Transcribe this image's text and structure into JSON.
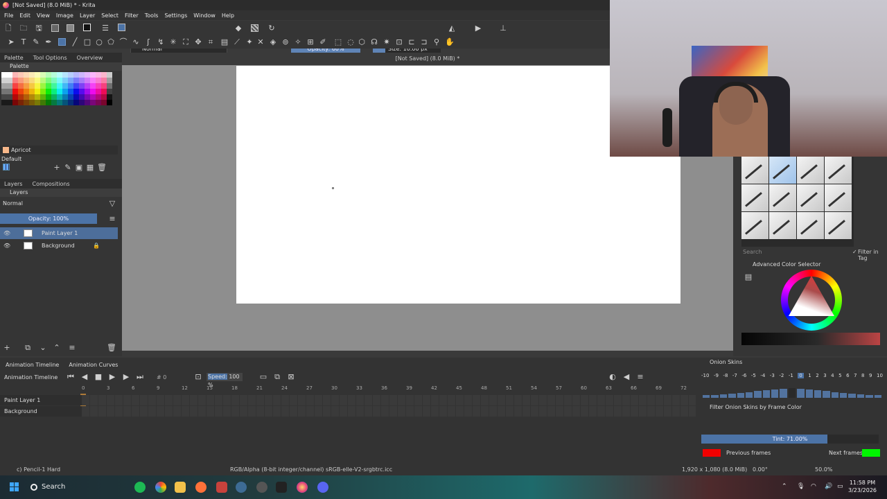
{
  "window": {
    "title": "[Not Saved]  (8.0 MiB) * - Krita"
  },
  "menu": [
    "File",
    "Edit",
    "View",
    "Image",
    "Layer",
    "Select",
    "Filter",
    "Tools",
    "Settings",
    "Window",
    "Help"
  ],
  "toolbar": {
    "blend_mode": "Normal",
    "opacity": "Opacity: 60%",
    "size": "Size: 10.00 px"
  },
  "left_dock": {
    "tabs": [
      "Palette",
      "Tool Options",
      "Overview"
    ],
    "palette_title": "Palette",
    "current_color": "Apricot",
    "palette_name": "Default",
    "layers_tabs": [
      "Layers",
      "Compositions"
    ],
    "layers_blend": "Normal",
    "layers_opacity": "Opacity:  100%",
    "layers": [
      {
        "name": "Paint Layer 1",
        "selected": true
      },
      {
        "name": "Background",
        "selected": false
      }
    ]
  },
  "canvas": {
    "header": "[Not Saved]  (8.0 MiB) *"
  },
  "right_dock": {
    "search_placeholder": "Search",
    "filter_in_tag": "Filter in Tag",
    "color_selector_title": "Advanced Color Selector"
  },
  "timeline": {
    "tabs": [
      "Animation Timeline",
      "Animation Curves"
    ],
    "title": "Animation Timeline",
    "frame": "0",
    "speed_label": "Speed:",
    "speed_value": "100 %",
    "ruler": [
      "0",
      "3",
      "6",
      "9",
      "12",
      "15",
      "18",
      "21",
      "24",
      "27",
      "30",
      "33",
      "36",
      "39",
      "42",
      "45",
      "48",
      "51",
      "54",
      "57",
      "60",
      "63",
      "66",
      "69",
      "72"
    ],
    "rows": [
      "Paint Layer 1",
      "Background"
    ]
  },
  "onion": {
    "title": "Onion Skins",
    "numbers": [
      "-10",
      "-9",
      "-8",
      "-7",
      "-6",
      "-5",
      "-4",
      "-3",
      "-2",
      "-1",
      "0",
      "1",
      "2",
      "3",
      "4",
      "5",
      "6",
      "7",
      "8",
      "9",
      "10"
    ],
    "filter_label": "Filter Onion Skins by Frame Color",
    "tint": "Tint: 71.00%",
    "tint_value": 0.71,
    "previous_label": "Previous frames",
    "next_label": "Next frames",
    "previous_color": "#f10000",
    "next_color": "#00f500"
  },
  "status": {
    "brush": "c) Pencil-1 Hard",
    "color_space": "RGB/Alpha (8-bit integer/channel)  sRGB-elle-V2-srgbtrc.icc",
    "dimensions": "1,920 x 1,080 (8.0 MiB)",
    "rotation": "0.00°",
    "zoom": "50.0%"
  },
  "taskbar": {
    "search": "Search",
    "time": "11:58 PM",
    "date": "3/23/2026"
  }
}
